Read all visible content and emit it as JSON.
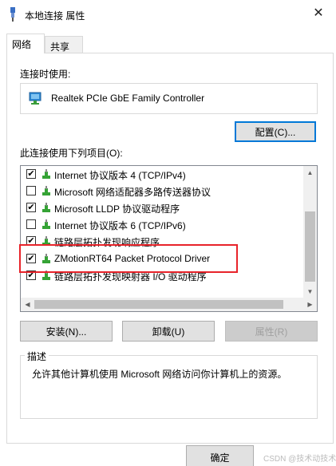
{
  "window": {
    "title": "本地连接 属性",
    "close_label": "✕"
  },
  "tabs": [
    {
      "label": "网络"
    },
    {
      "label": "共享"
    }
  ],
  "connect_using": {
    "label": "连接时使用:",
    "adapter": "Realtek PCIe GbE Family Controller",
    "configure_button": "配置(C)..."
  },
  "items_section": {
    "label": "此连接使用下列项目(O):",
    "items": [
      {
        "checked": true,
        "label": "Internet 协议版本 4 (TCP/IPv4)"
      },
      {
        "checked": false,
        "label": "Microsoft 网络适配器多路传送器协议"
      },
      {
        "checked": true,
        "label": "Microsoft LLDP 协议驱动程序"
      },
      {
        "checked": false,
        "label": "Internet 协议版本 6 (TCP/IPv6)"
      },
      {
        "checked": true,
        "label": "链路层拓扑发现响应程序"
      },
      {
        "checked": true,
        "label": "ZMotionRT64 Packet Protocol Driver"
      },
      {
        "checked": true,
        "label": "链路层拓扑发现映射器 I/O 驱动程序"
      }
    ]
  },
  "actions": {
    "install": "安装(N)...",
    "uninstall": "卸载(U)",
    "properties": "属性(R)"
  },
  "description": {
    "title": "描述",
    "text": "允许其他计算机使用 Microsoft 网络访问你计算机上的资源。"
  },
  "footer": {
    "ok": "确定"
  },
  "watermark": "CSDN @技术动技术",
  "colors": {
    "accent": "#0078d7",
    "highlight_border": "#e8232a",
    "button_face": "#e1e1e1"
  }
}
